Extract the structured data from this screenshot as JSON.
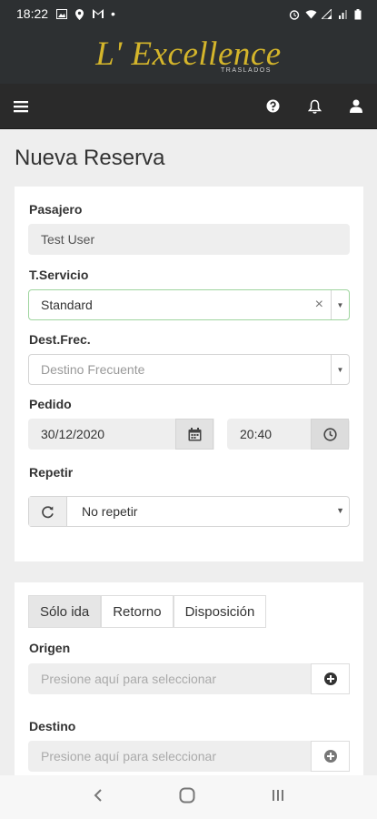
{
  "status_bar": {
    "time": "18:22",
    "dot": "•"
  },
  "brand": {
    "logo_text": "L' Excellence",
    "sub_text": "TRASLADOS"
  },
  "page": {
    "title": "Nueva Reserva"
  },
  "form": {
    "pasajero": {
      "label": "Pasajero",
      "value": "Test User"
    },
    "servicio": {
      "label": "T.Servicio",
      "value": "Standard",
      "clear": "×"
    },
    "destino_frecuente": {
      "label": "Dest.Frec.",
      "placeholder": "Destino Frecuente"
    },
    "pedido": {
      "label": "Pedido",
      "date": "30/12/2020",
      "time": "20:40"
    },
    "repetir": {
      "label": "Repetir",
      "value": "No repetir"
    }
  },
  "trip": {
    "tabs": [
      {
        "label": "Sólo ida",
        "active": true
      },
      {
        "label": "Retorno",
        "active": false
      },
      {
        "label": "Disposición",
        "active": false
      }
    ],
    "origen": {
      "label": "Origen",
      "placeholder": "Presione aquí para seleccionar"
    },
    "destino": {
      "label": "Destino",
      "placeholder": "Presione aquí para seleccionar"
    }
  },
  "icons": {
    "menu": "hamburger-icon",
    "help": "question-circle-icon",
    "notifications": "bell-icon",
    "profile": "user-icon",
    "calendar": "calendar-icon",
    "clock": "clock-icon",
    "repeat": "refresh-icon",
    "add": "plus-circle-icon"
  },
  "colors": {
    "header_bg": "#2d3032",
    "nav_bg": "#2a2a2a",
    "brand_gold": "#d4b52b",
    "page_bg": "#eeeeee"
  }
}
